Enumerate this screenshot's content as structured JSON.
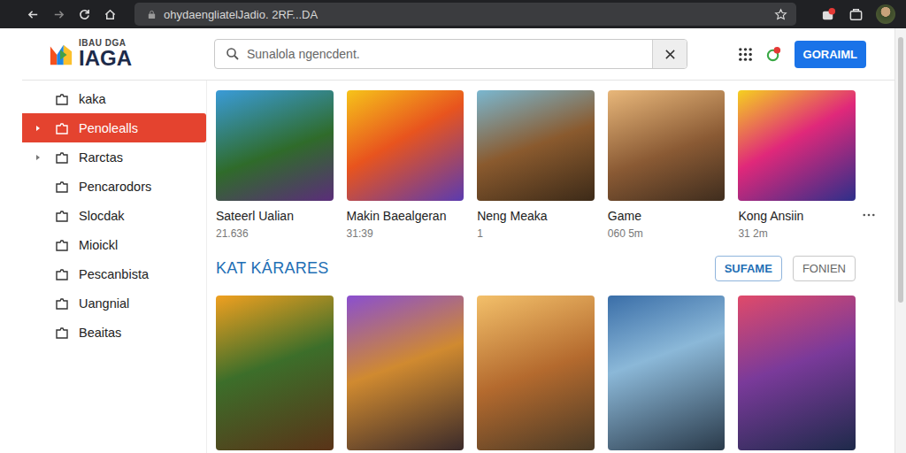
{
  "browser": {
    "url": "ohydaengliatelJadio. 2RF...DA"
  },
  "logo": {
    "top": "IBAU DGA",
    "main": "IAGA"
  },
  "search": {
    "placeholder": "Sunalola ngencdent."
  },
  "account_button": "GORAIML",
  "sidebar": {
    "items": [
      {
        "label": "kaka",
        "selected": false,
        "expandable": false
      },
      {
        "label": "Penolealls",
        "selected": true,
        "expandable": true
      },
      {
        "label": "Rarctas",
        "selected": false,
        "expandable": true
      },
      {
        "label": "Pencarodors",
        "selected": false,
        "expandable": false
      },
      {
        "label": "Slocdak",
        "selected": false,
        "expandable": false
      },
      {
        "label": "Mioickl",
        "selected": false,
        "expandable": false
      },
      {
        "label": "Pescanbista",
        "selected": false,
        "expandable": false
      },
      {
        "label": "Uangnial",
        "selected": false,
        "expandable": false
      },
      {
        "label": "Beaitas",
        "selected": false,
        "expandable": false
      }
    ]
  },
  "featured": [
    {
      "title": "Sateerl Ualian",
      "meta": "21.636",
      "more_menu": false
    },
    {
      "title": "Makin Baealgeran",
      "meta": "31:39",
      "more_menu": false
    },
    {
      "title": "Neng Meaka",
      "meta": "1",
      "more_menu": false
    },
    {
      "title": "Game",
      "meta": "060 5m",
      "more_menu": false
    },
    {
      "title": "Kong Ansiin",
      "meta": "31 2m",
      "more_menu": true
    }
  ],
  "section": {
    "title": "KAT KÁRARES",
    "filters": [
      {
        "label": "SUFAME",
        "selected": true
      },
      {
        "label": "FONIEN",
        "selected": false
      }
    ],
    "cards": [
      {
        "kind": "cover"
      },
      {
        "kind": "cover"
      },
      {
        "kind": "cover"
      },
      {
        "kind": "cover"
      },
      {
        "kind": "cover"
      }
    ]
  }
}
